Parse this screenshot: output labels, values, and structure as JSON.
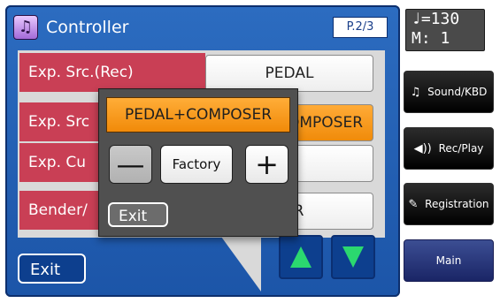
{
  "title_bar": {
    "icon": "music-note-icon",
    "title": "Controller",
    "page": "P.2/3"
  },
  "rows": [
    {
      "label": "Exp. Src.(Rec)",
      "value": "PEDAL",
      "selected": false
    },
    {
      "label": "Exp. Src",
      "value": "PEDAL+COMPOSER",
      "selected": true
    },
    {
      "label": "Exp. Cu",
      "value": "",
      "selected": false
    },
    {
      "label": "Bender/",
      "value": "PER",
      "selected": false
    }
  ],
  "popup": {
    "value": "PEDAL+COMPOSER",
    "minus": "—",
    "factory": "Factory",
    "plus": "+",
    "exit": "Exit"
  },
  "nav": {
    "exit": "Exit",
    "up_icon": "arrow-up-icon",
    "down_icon": "arrow-down-icon"
  },
  "side": {
    "tempo": "♩=130",
    "measure": "M:   1",
    "buttons": [
      {
        "label": "Sound/KBD",
        "icon": "♫"
      },
      {
        "label": "Rec/Play",
        "icon": "◀))"
      },
      {
        "label": "Registration",
        "icon": "✎"
      },
      {
        "label": "Main",
        "icon": ""
      }
    ]
  }
}
